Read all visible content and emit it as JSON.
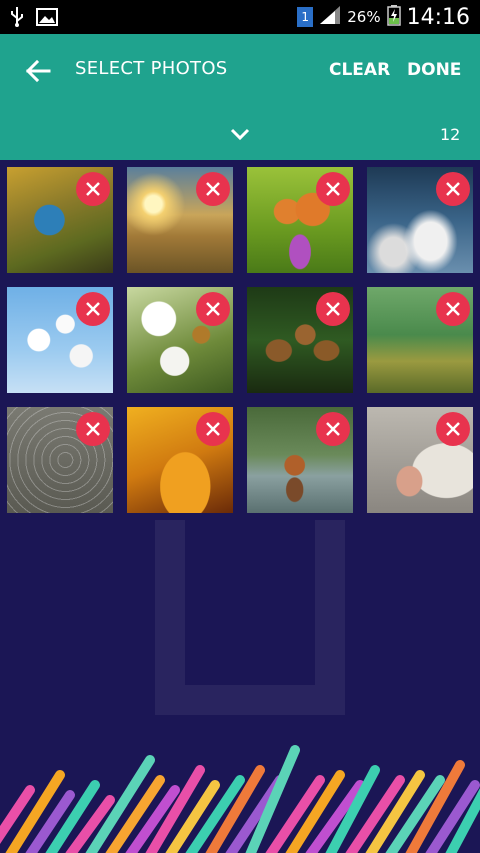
{
  "status_bar": {
    "battery_percent": "26%",
    "time": "14:16",
    "sim_label": "1"
  },
  "header": {
    "title": "SELECT PHOTOS",
    "clear_label": "CLEAR",
    "done_label": "DONE",
    "selected_count": "12"
  },
  "photos": [
    {
      "subject": "kingfisher",
      "icon": "close-icon"
    },
    {
      "subject": "sunrise-field",
      "icon": "close-icon"
    },
    {
      "subject": "butterfly-flower",
      "icon": "close-icon"
    },
    {
      "subject": "clouds",
      "icon": "close-icon"
    },
    {
      "subject": "white-blossoms",
      "icon": "close-icon"
    },
    {
      "subject": "bee-blossoms",
      "icon": "close-icon"
    },
    {
      "subject": "pine-cones",
      "icon": "close-icon"
    },
    {
      "subject": "moss",
      "icon": "close-icon"
    },
    {
      "subject": "dragonfly-web",
      "icon": "close-icon"
    },
    {
      "subject": "leaf-droplets",
      "icon": "close-icon"
    },
    {
      "subject": "fox-water",
      "icon": "close-icon"
    },
    {
      "subject": "goose",
      "icon": "close-icon"
    }
  ],
  "colors": {
    "appbar": "#1fa38e",
    "background": "#1b1655",
    "remove_badge": "#e8334e"
  }
}
